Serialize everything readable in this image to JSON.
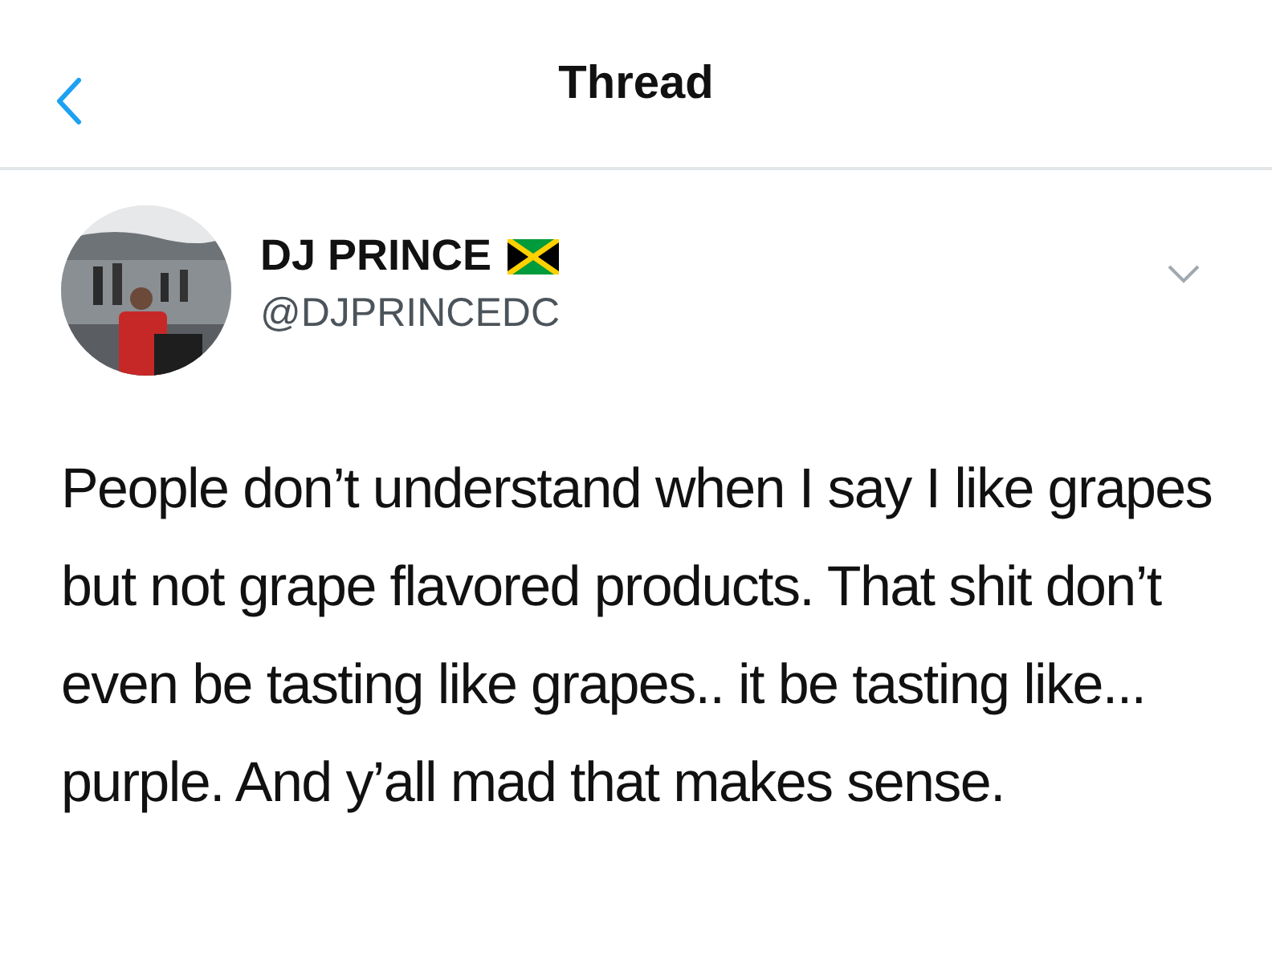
{
  "header": {
    "title": "Thread"
  },
  "tweet": {
    "author": {
      "name": "DJ PRINCE",
      "handle": "@DJPRINCEDC"
    },
    "text": "People don’t understand when I say I like grapes but not grape flavored products. That shit don’t even be tasting like grapes.. it be tasting like... purple. And y’all mad that makes sense."
  }
}
